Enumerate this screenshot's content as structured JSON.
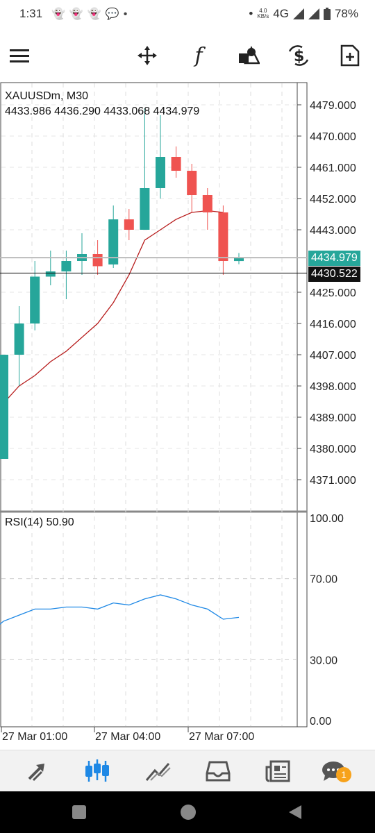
{
  "status": {
    "time": "1:31",
    "net_speed_top": "4.0",
    "net_speed_bottom": "KB/s",
    "network": "4G",
    "battery": "78%"
  },
  "toolbar": {
    "icons": [
      "menu-icon",
      "crosshair-icon",
      "function-icon",
      "shapes-icon",
      "trade-icon",
      "new-order-icon"
    ],
    "function_glyph": "f"
  },
  "chart_data": {
    "type": "candlestick",
    "symbol_line": "XAUUSDm, M30",
    "ohlc_line": "4433.986 4436.290 4433.068 4434.979",
    "price_axis": [
      "4479.000",
      "4470.000",
      "4461.000",
      "4452.000",
      "4443.000",
      "4425.000",
      "4416.000",
      "4407.000",
      "4398.000",
      "4389.000",
      "4380.000",
      "4371.000"
    ],
    "current_bid": "4434.979",
    "crosshair_price": "4430.522",
    "time_axis": [
      "27 Mar 01:00",
      "27 Mar 04:00",
      "27 Mar 07:00"
    ],
    "ylim": [
      4365,
      4484
    ],
    "candles": [
      {
        "o": 4377.0,
        "h": 4407.0,
        "l": 4377.0,
        "c": 4407.0
      },
      {
        "o": 4407.0,
        "h": 4421.0,
        "l": 4398.0,
        "c": 4416.0
      },
      {
        "o": 4416.0,
        "h": 4434.0,
        "l": 4414.0,
        "c": 4429.5
      },
      {
        "o": 4429.5,
        "h": 4437.0,
        "l": 4427.0,
        "c": 4431.0
      },
      {
        "o": 4431.0,
        "h": 4437.0,
        "l": 4423.0,
        "c": 4434.0
      },
      {
        "o": 4434.0,
        "h": 4442.0,
        "l": 4430.0,
        "c": 4436.0
      },
      {
        "o": 4436.0,
        "h": 4440.0,
        "l": 4430.0,
        "c": 4432.5
      },
      {
        "o": 4433.0,
        "h": 4450.0,
        "l": 4432.0,
        "c": 4446.0
      },
      {
        "o": 4446.0,
        "h": 4449.0,
        "l": 4440.0,
        "c": 4443.0
      },
      {
        "o": 4443.0,
        "h": 4478.0,
        "l": 4443.0,
        "c": 4455.0
      },
      {
        "o": 4455.0,
        "h": 4476.0,
        "l": 4452.0,
        "c": 4464.0
      },
      {
        "o": 4464.0,
        "h": 4467.0,
        "l": 4458.0,
        "c": 4460.0
      },
      {
        "o": 4460.0,
        "h": 4462.0,
        "l": 4448.0,
        "c": 4453.0
      },
      {
        "o": 4453.0,
        "h": 4455.0,
        "l": 4443.0,
        "c": 4448.0
      },
      {
        "o": 4448.0,
        "h": 4450.0,
        "l": 4430.0,
        "c": 4434.0
      },
      {
        "o": 4433.986,
        "h": 4436.29,
        "l": 4433.068,
        "c": 4434.979
      }
    ],
    "ma": [
      4393,
      4398,
      4401,
      4405,
      4408,
      4412,
      4416,
      4422,
      4430,
      4440,
      4443,
      4446,
      4448,
      4448.5,
      4448,
      null
    ],
    "rsi": {
      "label": "RSI(14) 50.90",
      "levels": [
        "100.00",
        "70.00",
        "30.00",
        "0.00"
      ],
      "values": [
        49,
        52,
        55,
        55,
        56,
        56,
        55,
        58,
        57,
        60,
        62,
        60,
        57,
        55,
        50,
        50.9
      ]
    },
    "colors": {
      "bull": "#26a69a",
      "bear": "#ef5350",
      "ma": "#b71c1c",
      "rsi": "#1e88e5"
    }
  },
  "bottomnav": {
    "items": [
      "quotes-icon",
      "chart-icon",
      "trade-icon",
      "history-icon",
      "news-icon",
      "messages-icon"
    ],
    "badge": "1"
  }
}
